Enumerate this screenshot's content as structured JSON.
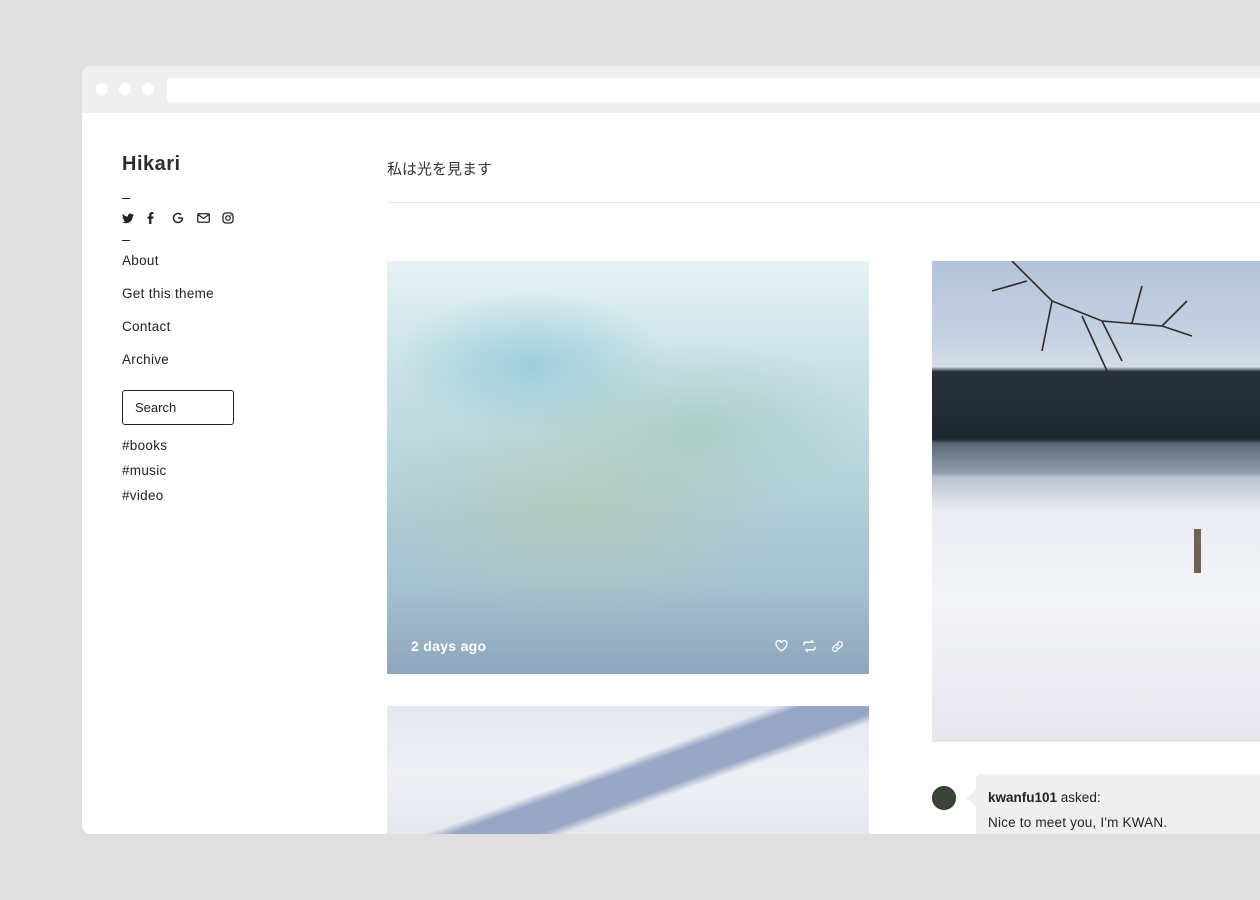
{
  "browser": {
    "window_controls": [
      "close",
      "minimize",
      "maximize"
    ],
    "address": ""
  },
  "sidebar": {
    "title": "Hikari",
    "social_icons": [
      "twitter-icon",
      "facebook-icon",
      "google-icon",
      "mail-icon",
      "instagram-icon"
    ],
    "nav": [
      "About",
      "Get this theme",
      "Contact",
      "Archive"
    ],
    "search_placeholder": "Search",
    "tags": [
      "#books",
      "#music",
      "#video"
    ]
  },
  "header": {
    "tagline": "私は光を見ます"
  },
  "posts": [
    {
      "type": "photo",
      "date": "2 days ago",
      "actions": [
        "heart-icon",
        "reblog-icon",
        "link-icon"
      ]
    },
    {
      "type": "photo"
    },
    {
      "type": "photo"
    }
  ],
  "ask": {
    "asker": "kwanfu101",
    "asked_label": "asked:",
    "question": "Nice to meet you, I'm KWAN."
  }
}
